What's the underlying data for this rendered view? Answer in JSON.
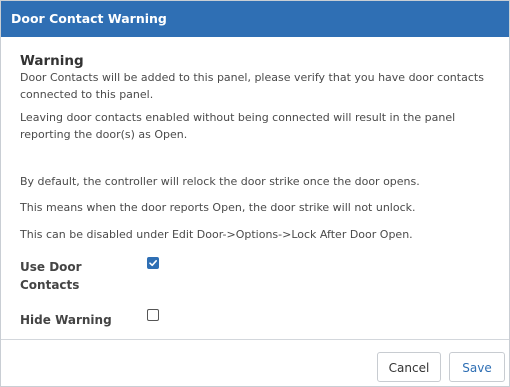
{
  "dialog": {
    "title": "Door Contact Warning",
    "heading": "Warning",
    "paragraphs": [
      "Door Contacts will be added to this panel, please verify that you have door contacts connected to this panel.",
      "Leaving door contacts enabled without being connected will result in the panel reporting the door(s) as Open.",
      "By default, the controller will relock the door strike once the door opens.",
      "This means when the door reports Open, the door strike will not unlock.",
      "This can be disabled under Edit Door->Options->Lock After Door Open."
    ],
    "fields": {
      "use_door_contacts": {
        "label": "Use Door Contacts",
        "checked": true
      },
      "hide_warning": {
        "label": "Hide Warning",
        "checked": false
      }
    },
    "buttons": {
      "cancel": "Cancel",
      "save": "Save"
    }
  },
  "colors": {
    "accent": "#2f6fb4",
    "titlebar_text": "#ffffff"
  }
}
